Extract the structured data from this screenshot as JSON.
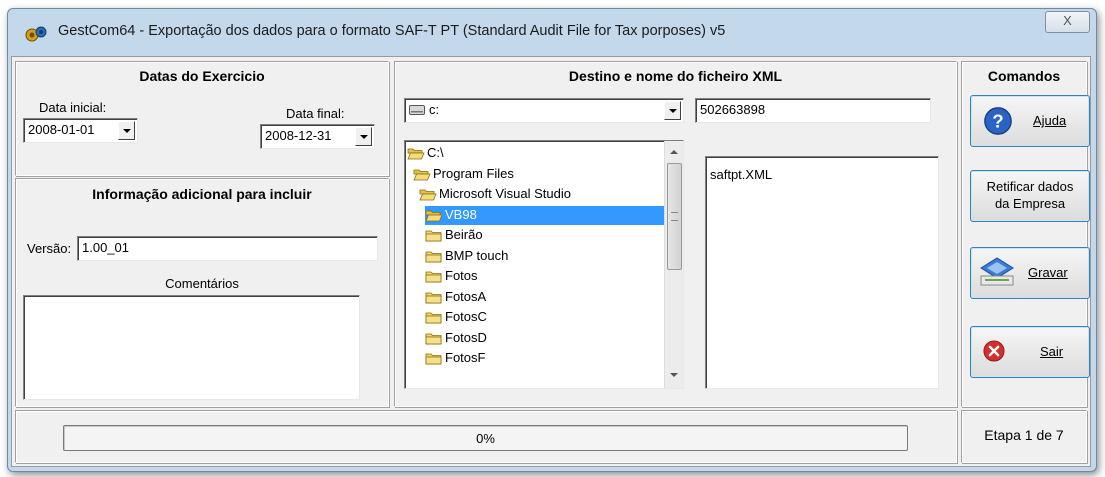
{
  "window": {
    "title": "GestCom64 - Exportação dos dados para o formato SAF-T PT (Standard Audit File for Tax porposes) v5",
    "close_glyph": "X",
    "frame_color": "#c4d8ec",
    "selection_color": "#3399ff"
  },
  "dates": {
    "title": "Datas do Exercicio",
    "start_label": "Data inicial:",
    "start_value": "2008-01-01",
    "end_label": "Data final:",
    "end_value": "2008-12-31"
  },
  "additional": {
    "title": "Informação adicional para incluir",
    "version_label": "Versão:",
    "version_value": "1.00_01",
    "comments_label": "Comentários",
    "comments_value": ""
  },
  "destination": {
    "title": "Destino e nome do ficheiro XML",
    "drive_value": "c:",
    "filename_value": "502663898",
    "folders": [
      {
        "label": "C:\\",
        "icon": "open-folder-icon",
        "selected": false
      },
      {
        "label": "Program Files",
        "icon": "open-folder-icon",
        "selected": false
      },
      {
        "label": "Microsoft Visual Studio",
        "icon": "open-folder-icon",
        "selected": false
      },
      {
        "label": "VB98",
        "icon": "open-folder-icon",
        "selected": true
      },
      {
        "label": "Beirão",
        "icon": "folder-icon",
        "selected": false
      },
      {
        "label": "BMP touch",
        "icon": "folder-icon",
        "selected": false
      },
      {
        "label": "Fotos",
        "icon": "folder-icon",
        "selected": false
      },
      {
        "label": "FotosA",
        "icon": "folder-icon",
        "selected": false
      },
      {
        "label": "FotosC",
        "icon": "folder-icon",
        "selected": false
      },
      {
        "label": "FotosD",
        "icon": "folder-icon",
        "selected": false
      },
      {
        "label": "FotosF",
        "icon": "folder-icon",
        "selected": false
      }
    ],
    "files": [
      "saftpt.XML"
    ]
  },
  "commands": {
    "title": "Comandos",
    "help_label": "Ajuda",
    "rectify_label_line1": "Retificar dados",
    "rectify_label_line2": "da Empresa",
    "save_label": "Gravar",
    "exit_label": "Sair"
  },
  "status": {
    "progress_percent": 0,
    "progress_text": "0%",
    "step_text": "Etapa 1 de 7"
  }
}
